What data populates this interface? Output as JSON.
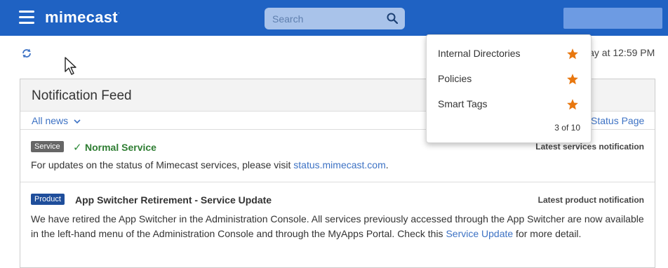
{
  "header": {
    "brand": "mimecast",
    "brand_mark": "·",
    "search_placeholder": "Search"
  },
  "toolbar": {
    "last_updated": "lay at 12:59 PM"
  },
  "feed": {
    "title": "Notification Feed",
    "filter_label": "All news",
    "status_link": "Status Page",
    "items": [
      {
        "badge": "Service",
        "status": "Normal Service",
        "latest_label": "Latest services notification",
        "text_prefix": "For updates on the status of Mimecast services, please visit ",
        "link": "status.mimecast.com",
        "text_suffix": "."
      },
      {
        "badge": "Product",
        "title": "App Switcher Retirement - Service Update",
        "latest_label": "Latest product notification",
        "text_prefix": "We have retired the App Switcher in the Administration Console. All services previously accessed through the App Switcher are now available in the left-hand menu of the Administration Console and through the MyApps Portal. Check this ",
        "link": "Service Update",
        "text_suffix": " for more detail."
      }
    ]
  },
  "favorites_dropdown": {
    "items": [
      {
        "label": "Internal Directories",
        "starred": true
      },
      {
        "label": "Policies",
        "starred": true
      },
      {
        "label": "Smart Tags",
        "starred": true
      }
    ],
    "count": "3 of 10"
  },
  "colors": {
    "header_bg": "#1f62c3",
    "link": "#3d72c4",
    "star": "#e8770f",
    "normal_service": "#2e7d32"
  }
}
